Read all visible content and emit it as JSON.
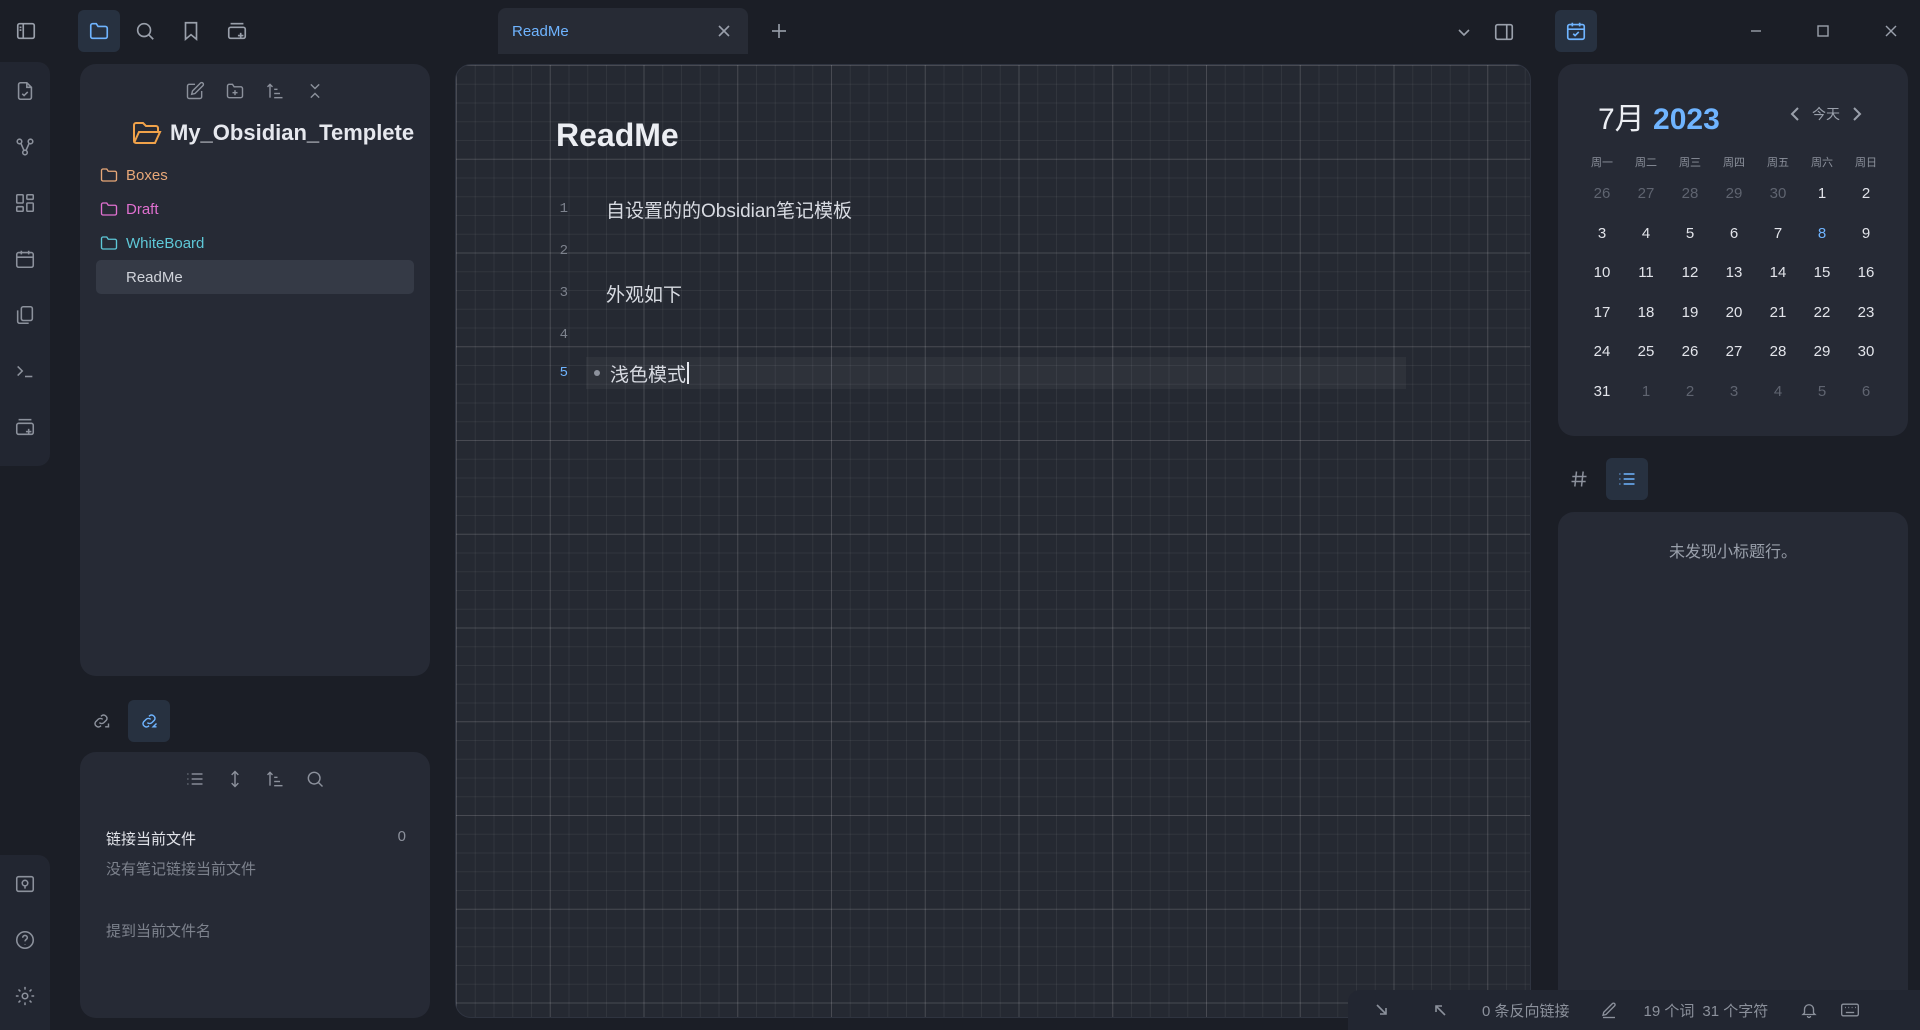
{
  "tabs": {
    "active_title": "ReadMe"
  },
  "explorer": {
    "vault_name": "My_Obsidian_Templete",
    "items": [
      {
        "label": "Boxes",
        "type": "folder",
        "color": "#e8a878"
      },
      {
        "label": "Draft",
        "type": "folder",
        "color": "#e070d0"
      },
      {
        "label": "WhiteBoard",
        "type": "folder",
        "color": "#5ec8d8"
      },
      {
        "label": "ReadMe",
        "type": "file",
        "color": "#d0d3da"
      }
    ]
  },
  "backlinks": {
    "linked_title": "链接当前文件",
    "linked_count": "0",
    "linked_empty": "没有笔记链接当前文件",
    "unlinked_title": "提到当前文件名"
  },
  "editor": {
    "title": "ReadMe",
    "lines": [
      {
        "num": "1",
        "text": "自设置的的Obsidian笔记模板"
      },
      {
        "num": "2",
        "text": ""
      },
      {
        "num": "3",
        "text": "外观如下"
      },
      {
        "num": "4",
        "text": ""
      },
      {
        "num": "5",
        "text": "浅色模式"
      }
    ]
  },
  "calendar": {
    "month": "7月",
    "year": "2023",
    "today_label": "今天",
    "weekdays": [
      "周一",
      "周二",
      "周三",
      "周四",
      "周五",
      "周六",
      "周日"
    ],
    "days": [
      [
        "26",
        "27",
        "28",
        "29",
        "30",
        "1",
        "2"
      ],
      [
        "3",
        "4",
        "5",
        "6",
        "7",
        "8",
        "9"
      ],
      [
        "10",
        "11",
        "12",
        "13",
        "14",
        "15",
        "16"
      ],
      [
        "17",
        "18",
        "19",
        "20",
        "21",
        "22",
        "23"
      ],
      [
        "24",
        "25",
        "26",
        "27",
        "28",
        "29",
        "30"
      ],
      [
        "31",
        "1",
        "2",
        "3",
        "4",
        "5",
        "6"
      ]
    ],
    "today_day": "8"
  },
  "outline": {
    "empty_message": "未发现小标题行。"
  },
  "status_bar": {
    "backlinks": "0 条反向链接",
    "word_count": "19 个词",
    "char_count": "31 个字符"
  },
  "colors": {
    "accent": "#6fb4ff"
  }
}
